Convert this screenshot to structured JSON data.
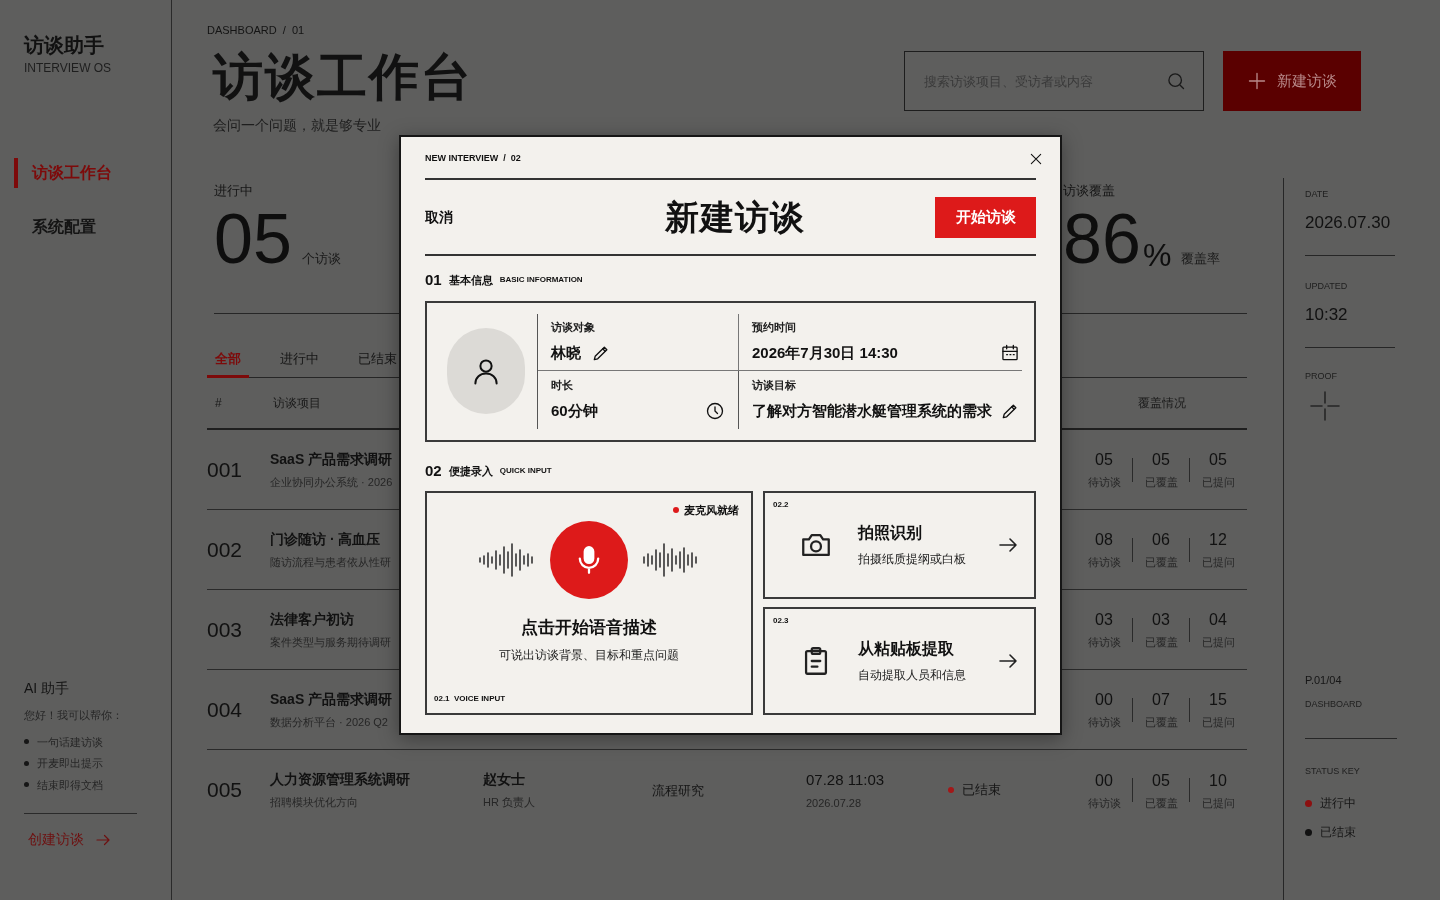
{
  "sidebar": {
    "brand_title": "访谈助手",
    "brand_subtitle": "INTERVIEW OS",
    "nav": [
      {
        "label": "访谈工作台",
        "selected": true
      },
      {
        "label": "系统配置",
        "selected": false
      }
    ],
    "assistant": {
      "title": "AI 助手",
      "greeting": "您好！我可以帮你：",
      "tips": [
        "一句话建访谈",
        "开麦即出提示",
        "结束即得文档"
      ],
      "link": "创建访谈"
    }
  },
  "header": {
    "breadcrumb": "DASHBOARD  /  01",
    "title": "访谈工作台",
    "subtitle": "会问一个问题，就是够专业",
    "search_placeholder": "搜索访谈项目、受访者或内容",
    "new_button": "新建访谈"
  },
  "stats": [
    {
      "label": "进行中",
      "value": "05",
      "unit": "个访谈"
    },
    {
      "label": "访谈覆盖",
      "value": "86",
      "suffix": "%",
      "unit": "覆盖率"
    }
  ],
  "tabs": [
    {
      "label": "全部",
      "selected": true
    },
    {
      "label": "进行中",
      "selected": false
    },
    {
      "label": "已结束",
      "selected": false
    }
  ],
  "table": {
    "columns": [
      "#",
      "访谈项目",
      "覆盖情况"
    ],
    "rows": [
      {
        "id": "001",
        "title": "SaaS 产品需求调研",
        "subtitle": "企业协同办公系统 · 2026",
        "counts": [
          {
            "value": "05",
            "label": "待访谈"
          },
          {
            "value": "05",
            "label": "已覆盖"
          },
          {
            "value": "05",
            "label": "已提问"
          }
        ]
      },
      {
        "id": "002",
        "title": "门诊随访 · 高血压",
        "subtitle": "随访流程与患者依从性研",
        "counts": [
          {
            "value": "08",
            "label": "待访谈"
          },
          {
            "value": "06",
            "label": "已覆盖"
          },
          {
            "value": "12",
            "label": "已提问"
          }
        ]
      },
      {
        "id": "003",
        "title": "法律客户初访",
        "subtitle": "案件类型与服务期待调研",
        "counts": [
          {
            "value": "03",
            "label": "待访谈"
          },
          {
            "value": "03",
            "label": "已覆盖"
          },
          {
            "value": "04",
            "label": "已提问"
          }
        ]
      },
      {
        "id": "004",
        "title": "SaaS 产品需求调研",
        "subtitle": "数据分析平台 · 2026 Q2",
        "counts": [
          {
            "value": "00",
            "label": "待访谈"
          },
          {
            "value": "07",
            "label": "已覆盖"
          },
          {
            "value": "15",
            "label": "已提问"
          }
        ]
      },
      {
        "id": "005",
        "title": "人力资源管理系统调研",
        "subtitle": "招聘模块优化方向",
        "interviewee": "赵女士",
        "role": "HR 负责人",
        "type": "流程研究",
        "time": "07.28 11:03",
        "date": "2026.07.28",
        "status": {
          "label": "已结束",
          "color": "#a31818"
        },
        "counts": [
          {
            "value": "00",
            "label": "待访谈"
          },
          {
            "value": "05",
            "label": "已覆盖"
          },
          {
            "value": "10",
            "label": "已提问"
          }
        ]
      }
    ]
  },
  "info_panel": {
    "date_label": "DATE",
    "date": "2026.07.30",
    "updated_label": "UPDATED",
    "updated": "10:32",
    "proof_label": "PROOF",
    "page": "P.01/04",
    "page_label": "DASHBOARD",
    "status_key_label": "STATUS KEY",
    "status_key": [
      {
        "label": "进行中",
        "color": "#8c1010"
      },
      {
        "label": "已结束",
        "color": "#111111"
      }
    ]
  },
  "modal": {
    "breadcrumb": "NEW INTERVIEW  /  02",
    "cancel": "取消",
    "title": "新建访谈",
    "start_button": "开始访谈",
    "sections": [
      {
        "number": "01",
        "title": "基本信息",
        "subtitle": "BASIC INFORMATION"
      },
      {
        "number": "02",
        "title": "便捷录入",
        "subtitle": "QUICK INPUT"
      }
    ],
    "fields": [
      {
        "label": "访谈对象",
        "value": "林晓",
        "kind": "editable"
      },
      {
        "label": "预约时间",
        "value": "2026年7月30日 14:30",
        "kind": "date"
      },
      {
        "label": "时长",
        "value": "60分钟",
        "kind": "duration"
      },
      {
        "label": "访谈目标",
        "value": "了解对方智能潜水艇管理系统的需求",
        "kind": "editable"
      }
    ],
    "voice": {
      "status": "麦克风就绪",
      "title": "点击开始语音描述",
      "hint": "可说出访谈背景、目标和重点问题",
      "tag": "02.1  VOICE INPUT"
    },
    "quick_cards": [
      {
        "tag": "02.2",
        "title": "拍照识别",
        "hint": "拍摄纸质提纲或白板",
        "kind": "photo"
      },
      {
        "tag": "02.3",
        "title": "从粘贴板提取",
        "hint": "自动提取人员和信息",
        "kind": "paste"
      }
    ]
  }
}
